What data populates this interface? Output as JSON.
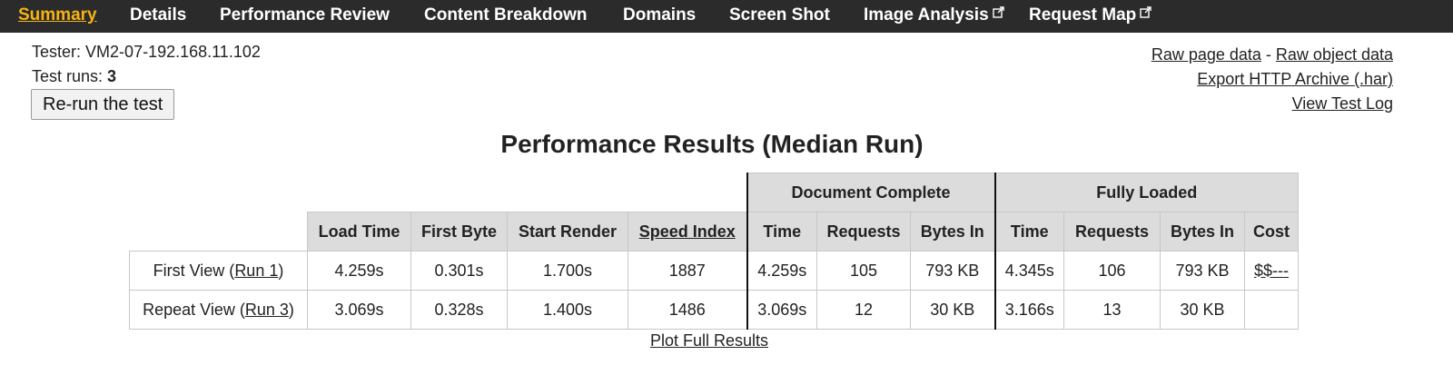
{
  "nav": {
    "items": [
      {
        "label": "Summary",
        "active": true
      },
      {
        "label": "Details"
      },
      {
        "label": "Performance Review"
      },
      {
        "label": "Content Breakdown"
      },
      {
        "label": "Domains"
      },
      {
        "label": "Screen Shot"
      },
      {
        "label": "Image Analysis",
        "external": true
      },
      {
        "label": "Request Map",
        "external": true
      }
    ],
    "active_color": "#f4b414"
  },
  "tester": {
    "label": "Tester:",
    "value": "VM2-07-192.168.11.102",
    "runs_label": "Test runs:",
    "runs_value": "3",
    "rerun_label": "Re-run the test"
  },
  "links": {
    "raw_page": "Raw page data",
    "separator": " - ",
    "raw_object": "Raw object data",
    "export_har": "Export HTTP Archive (.har)",
    "test_log": "View Test Log"
  },
  "results": {
    "title": "Performance Results (Median Run)",
    "group_doc": "Document Complete",
    "group_full": "Fully Loaded",
    "headers": {
      "load_time": "Load Time",
      "first_byte": "First Byte",
      "start_render": "Start Render",
      "speed_index": "Speed Index",
      "doc_time": "Time",
      "doc_requests": "Requests",
      "doc_bytes": "Bytes In",
      "full_time": "Time",
      "full_requests": "Requests",
      "full_bytes": "Bytes In",
      "cost": "Cost"
    },
    "rows": [
      {
        "label_pre": "First View (",
        "run_link": "Run 1",
        "label_post": ")",
        "load_time": "4.259s",
        "first_byte": "0.301s",
        "start_render": "1.700s",
        "speed_index": "1887",
        "doc_time": "4.259s",
        "doc_requests": "105",
        "doc_bytes": "793 KB",
        "full_time": "4.345s",
        "full_requests": "106",
        "full_bytes": "793 KB",
        "cost": "$$---"
      },
      {
        "label_pre": "Repeat View (",
        "run_link": "Run 3",
        "label_post": ")",
        "load_time": "3.069s",
        "first_byte": "0.328s",
        "start_render": "1.400s",
        "speed_index": "1486",
        "doc_time": "3.069s",
        "doc_requests": "12",
        "doc_bytes": "30 KB",
        "full_time": "3.166s",
        "full_requests": "13",
        "full_bytes": "30 KB",
        "cost": ""
      }
    ],
    "plot_link": "Plot Full Results"
  }
}
